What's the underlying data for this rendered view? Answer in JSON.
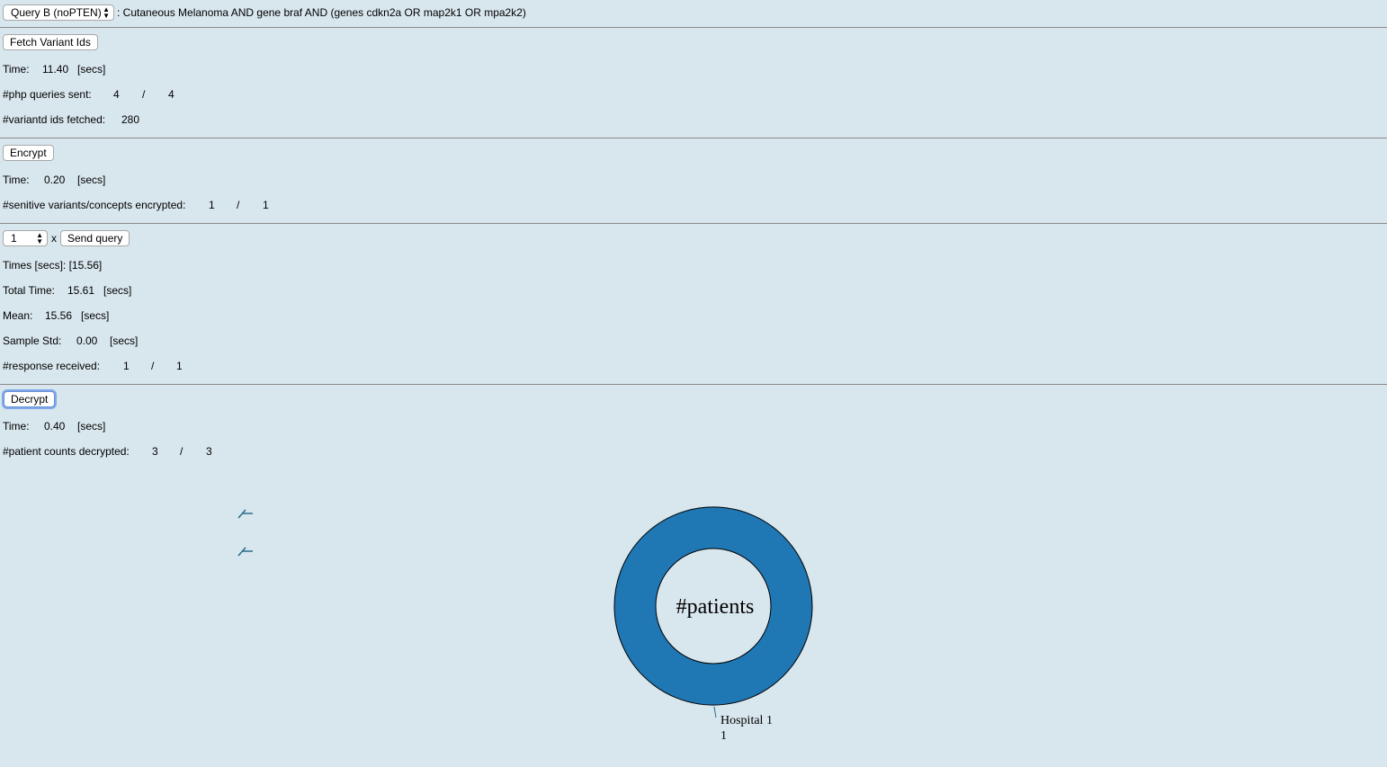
{
  "query": {
    "select_value": "Query B (noPTEN)",
    "description": ": Cutaneous Melanoma AND gene braf AND (genes cdkn2a OR map2k1 OR mpa2k2)"
  },
  "fetch": {
    "button_label": "Fetch Variant Ids",
    "time_label": "Time:",
    "time_value": "11.40",
    "time_unit": "[secs]",
    "php_label": "#php queries sent:",
    "php_sent": "4",
    "php_sep": "/",
    "php_total": "4",
    "variant_label": "#variantd ids fetched:",
    "variant_value": "280"
  },
  "encrypt": {
    "button_label": "Encrypt",
    "time_label": "Time:",
    "time_value": "0.20",
    "time_unit": "[secs]",
    "sens_label": "#senitive variants/concepts encrypted:",
    "sens_done": "1",
    "sens_sep": "/",
    "sens_total": "1"
  },
  "send": {
    "repeat_value": "1",
    "times_symbol": "x",
    "button_label": "Send query",
    "times_text": "Times [secs]: [15.56]",
    "total_label": "Total Time:",
    "total_value": "15.61",
    "total_unit": "[secs]",
    "mean_label": "Mean:",
    "mean_value": "15.56",
    "mean_unit": "[secs]",
    "std_label": "Sample Std:",
    "std_value": "0.00",
    "std_unit": "[secs]",
    "resp_label": "#response received:",
    "resp_done": "1",
    "resp_sep": "/",
    "resp_total": "1"
  },
  "decrypt": {
    "button_label": "Decrypt",
    "time_label": "Time:",
    "time_value": "0.40",
    "time_unit": "[secs]",
    "count_label": "#patient counts decrypted:",
    "count_done": "3",
    "count_sep": "/",
    "count_total": "3"
  },
  "chart_data": {
    "type": "pie",
    "center_label": "#patients",
    "slices": [
      {
        "name": "Hospital 1",
        "value": 1,
        "color": "#1f77b4"
      }
    ]
  }
}
